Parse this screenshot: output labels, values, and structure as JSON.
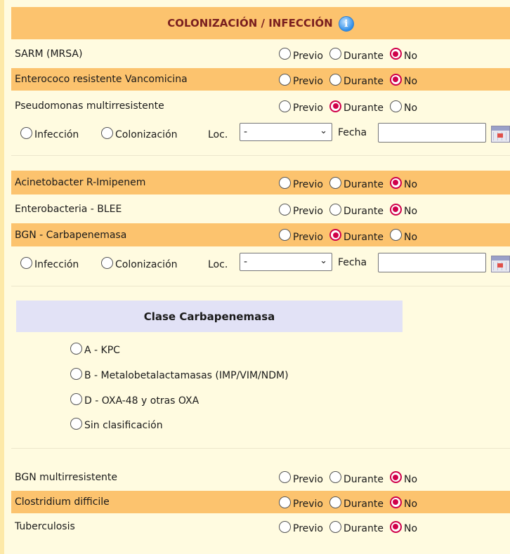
{
  "header": {
    "title": "COLONIZACIÓN / INFECCIÓN",
    "info_icon": "info-icon",
    "info_glyph": "i"
  },
  "option_labels": {
    "previo": "Previo",
    "durante": "Durante",
    "no": "No"
  },
  "organisms": [
    {
      "name": "SARM (MRSA)",
      "selected": "No"
    },
    {
      "name": "Enterococo resistente Vancomicina",
      "selected": "No"
    },
    {
      "name": "Pseudomonas multirresistente",
      "selected": "Durante"
    },
    {
      "name": "Acinetobacter R-Imipenem",
      "selected": "No"
    },
    {
      "name": "Enterobacteria - BLEE",
      "selected": "No"
    },
    {
      "name": "BGN - Carbapenemasa",
      "selected": "Durante"
    },
    {
      "name": "BGN multirresistente",
      "selected": "No"
    },
    {
      "name": "Clostridium difficile",
      "selected": "No"
    },
    {
      "name": "Tuberculosis",
      "selected": "No"
    }
  ],
  "detail": {
    "infeccion_label": "Infección",
    "colonizacion_label": "Colonización",
    "loc_label": "Loc.",
    "loc_value": "-",
    "fecha_label": "Fecha",
    "fecha_value": "",
    "calendar_icon": "calendar-icon"
  },
  "clase_carbapenemasa": {
    "title": "Clase Carbapenemasa",
    "options": [
      "A - KPC",
      "B - Metalobetalactamasas (IMP/VIM/NDM)",
      "D - OXA-48 y otras OXA",
      "Sin clasificación"
    ]
  },
  "colors": {
    "row_orange": "#fcc36e",
    "row_pale": "#fffbe0",
    "radio_selected": "#d0004a",
    "clase_header": "#e2e2f6"
  }
}
